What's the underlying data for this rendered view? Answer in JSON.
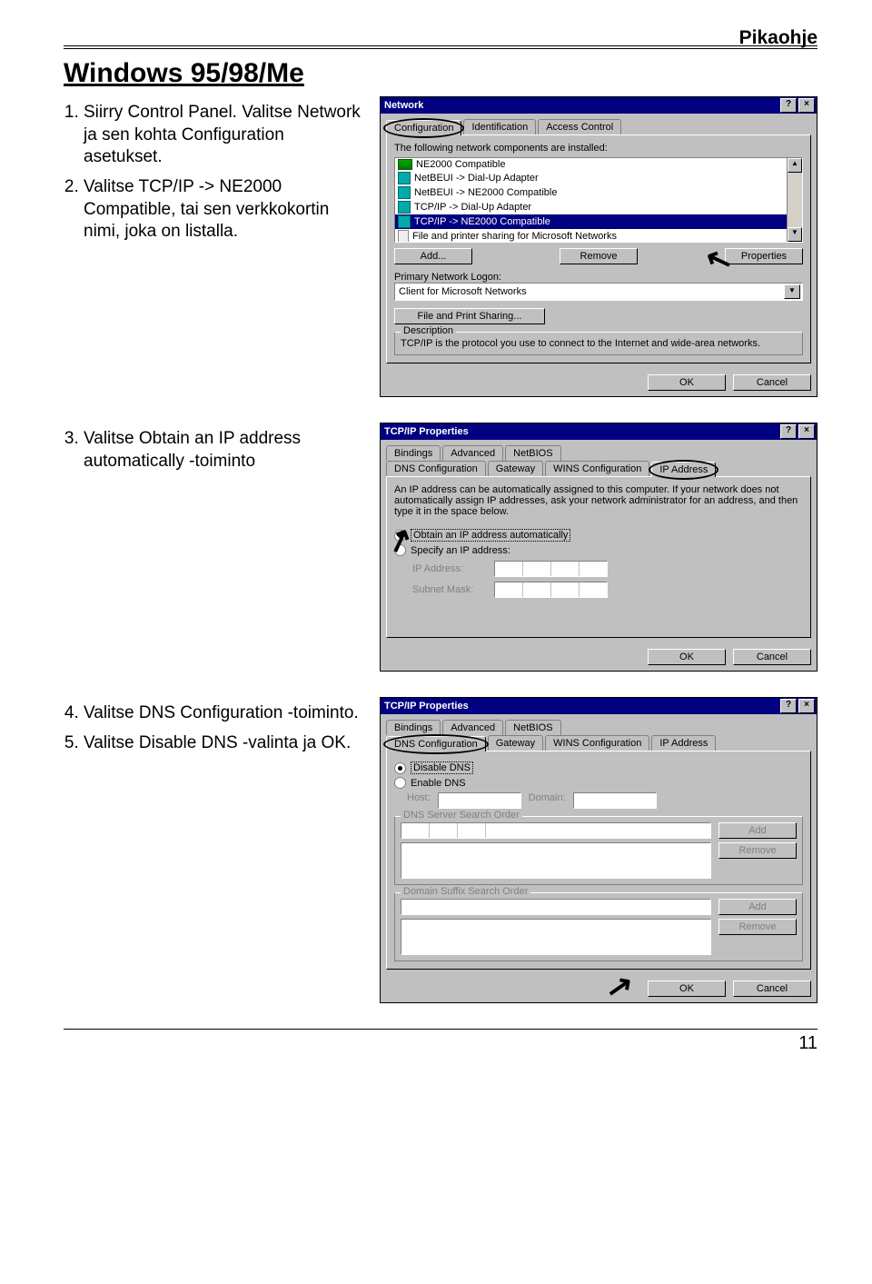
{
  "header": {
    "label": "Pikaohje"
  },
  "title": "Windows 95/98/Me",
  "steps": {
    "s1": "Siirry Control Panel. Valitse Network ja sen kohta Configuration asetukset.",
    "s2": "Valitse TCP/IP -> NE2000 Compatible, tai sen verkkokortin nimi, joka on listalla.",
    "s3": "Valitse Obtain an IP address automatically -toiminto",
    "s4": "Valitse DNS Configuration -toiminto.",
    "s5": "Valitse Disable DNS -valinta ja OK."
  },
  "dlg1": {
    "title": "Network",
    "tabs": [
      "Configuration",
      "Identification",
      "Access Control"
    ],
    "intro": "The following network components are installed:",
    "items": [
      "NE2000 Compatible",
      "NetBEUI -> Dial-Up Adapter",
      "NetBEUI -> NE2000 Compatible",
      "TCP/IP -> Dial-Up Adapter",
      "TCP/IP -> NE2000 Compatible",
      "File and printer sharing for Microsoft Networks"
    ],
    "btn_add": "Add...",
    "btn_remove": "Remove",
    "btn_props": "Properties",
    "logon_label": "Primary Network Logon:",
    "logon_value": "Client for Microsoft Networks",
    "btn_fps": "File and Print Sharing...",
    "desc_label": "Description",
    "desc_text": "TCP/IP is the protocol you use to connect to the Internet and wide-area networks.",
    "ok": "OK",
    "cancel": "Cancel"
  },
  "dlg2": {
    "title": "TCP/IP Properties",
    "tabs_top": [
      "Bindings",
      "Advanced",
      "NetBIOS"
    ],
    "tabs_bot": [
      "DNS Configuration",
      "Gateway",
      "WINS Configuration",
      "IP Address"
    ],
    "intro": "An IP address can be automatically assigned to this computer. If your network does not automatically assign IP addresses, ask your network administrator for an address, and then type it in the space below.",
    "opt_auto": "Obtain an IP address automatically",
    "opt_spec": "Specify an IP address:",
    "ip_label": "IP Address:",
    "mask_label": "Subnet Mask:",
    "ok": "OK",
    "cancel": "Cancel"
  },
  "dlg3": {
    "title": "TCP/IP Properties",
    "tabs_top": [
      "Bindings",
      "Advanced",
      "NetBIOS"
    ],
    "tabs_bot": [
      "DNS Configuration",
      "Gateway",
      "WINS Configuration",
      "IP Address"
    ],
    "opt_disable": "Disable DNS",
    "opt_enable": "Enable DNS",
    "host": "Host:",
    "domain": "Domain:",
    "dns_order": "DNS Server Search Order",
    "suffix_order": "Domain Suffix Search Order",
    "add": "Add",
    "remove": "Remove",
    "ok": "OK",
    "cancel": "Cancel"
  },
  "page_number": "11"
}
